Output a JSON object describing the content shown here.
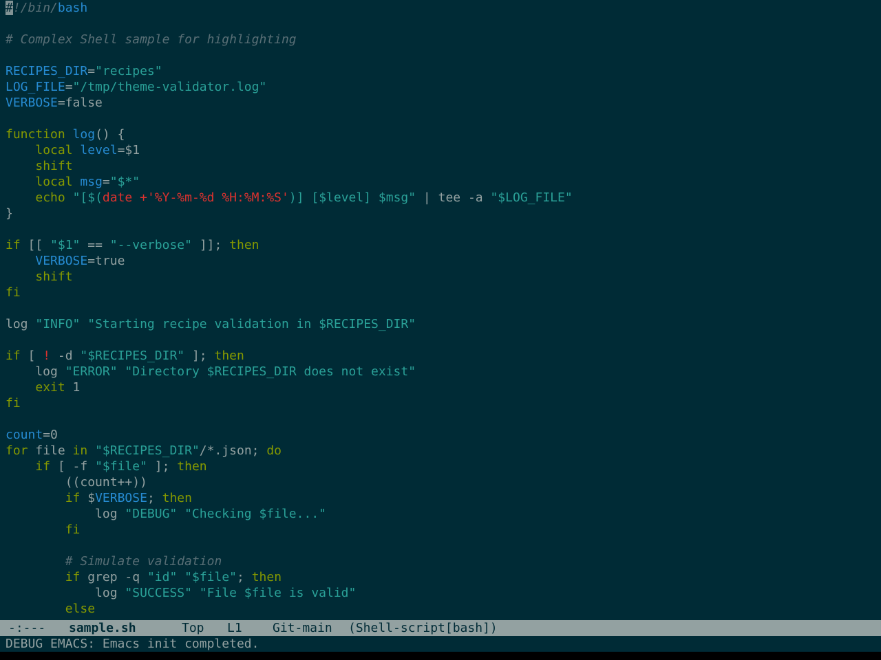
{
  "editor": {
    "lines": [
      [
        [
          "cursor",
          "#"
        ],
        [
          "comment",
          "!/bin/"
        ],
        [
          "var",
          "bash"
        ]
      ],
      [],
      [
        [
          "comment",
          "# Complex Shell sample for highlighting"
        ]
      ],
      [],
      [
        [
          "var",
          "RECIPES_DIR"
        ],
        [
          "text",
          "="
        ],
        [
          "string",
          "\"recipes\""
        ]
      ],
      [
        [
          "var",
          "LOG_FILE"
        ],
        [
          "text",
          "="
        ],
        [
          "string",
          "\"/tmp/theme-validator.log\""
        ]
      ],
      [
        [
          "var",
          "VERBOSE"
        ],
        [
          "text",
          "=false"
        ]
      ],
      [],
      [
        [
          "keyword",
          "function"
        ],
        [
          "text",
          " "
        ],
        [
          "var",
          "log"
        ],
        [
          "text",
          "() {"
        ]
      ],
      [
        [
          "text",
          "    "
        ],
        [
          "builtin",
          "local"
        ],
        [
          "text",
          " "
        ],
        [
          "var",
          "level"
        ],
        [
          "text",
          "=$1"
        ]
      ],
      [
        [
          "text",
          "    "
        ],
        [
          "builtin",
          "shift"
        ]
      ],
      [
        [
          "text",
          "    "
        ],
        [
          "builtin",
          "local"
        ],
        [
          "text",
          " "
        ],
        [
          "var",
          "msg"
        ],
        [
          "text",
          "="
        ],
        [
          "string",
          "\"$*\""
        ]
      ],
      [
        [
          "text",
          "    "
        ],
        [
          "builtin",
          "echo"
        ],
        [
          "text",
          " "
        ],
        [
          "string",
          "\"[$("
        ],
        [
          "interp",
          "date +'%Y-%m-%d %H:%M:%S'"
        ],
        [
          "string",
          ")] [$level] $msg\""
        ],
        [
          "text",
          " | tee -a "
        ],
        [
          "string",
          "\"$LOG_FILE\""
        ]
      ],
      [
        [
          "text",
          "}"
        ]
      ],
      [],
      [
        [
          "keyword",
          "if"
        ],
        [
          "text",
          " [[ "
        ],
        [
          "string",
          "\"$1\""
        ],
        [
          "text",
          " == "
        ],
        [
          "string",
          "\"--verbose\""
        ],
        [
          "text",
          " ]]; "
        ],
        [
          "keyword",
          "then"
        ]
      ],
      [
        [
          "text",
          "    "
        ],
        [
          "var",
          "VERBOSE"
        ],
        [
          "text",
          "=true"
        ]
      ],
      [
        [
          "text",
          "    "
        ],
        [
          "builtin",
          "shift"
        ]
      ],
      [
        [
          "keyword",
          "fi"
        ]
      ],
      [],
      [
        [
          "text",
          "log "
        ],
        [
          "string",
          "\"INFO\""
        ],
        [
          "text",
          " "
        ],
        [
          "string",
          "\"Starting recipe validation in $RECIPES_DIR\""
        ]
      ],
      [],
      [
        [
          "keyword",
          "if"
        ],
        [
          "text",
          " [ "
        ],
        [
          "interp",
          "!"
        ],
        [
          "text",
          " -d "
        ],
        [
          "string",
          "\"$RECIPES_DIR\""
        ],
        [
          "text",
          " ]; "
        ],
        [
          "keyword",
          "then"
        ]
      ],
      [
        [
          "text",
          "    log "
        ],
        [
          "string",
          "\"ERROR\""
        ],
        [
          "text",
          " "
        ],
        [
          "string",
          "\"Directory $RECIPES_DIR does not exist\""
        ]
      ],
      [
        [
          "text",
          "    "
        ],
        [
          "builtin",
          "exit"
        ],
        [
          "text",
          " 1"
        ]
      ],
      [
        [
          "keyword",
          "fi"
        ]
      ],
      [],
      [
        [
          "var",
          "count"
        ],
        [
          "text",
          "=0"
        ]
      ],
      [
        [
          "keyword",
          "for"
        ],
        [
          "text",
          " file "
        ],
        [
          "keyword",
          "in"
        ],
        [
          "text",
          " "
        ],
        [
          "string",
          "\"$RECIPES_DIR\""
        ],
        [
          "text",
          "/*.json; "
        ],
        [
          "keyword",
          "do"
        ]
      ],
      [
        [
          "text",
          "    "
        ],
        [
          "keyword",
          "if"
        ],
        [
          "text",
          " [ -f "
        ],
        [
          "string",
          "\"$file\""
        ],
        [
          "text",
          " ]; "
        ],
        [
          "keyword",
          "then"
        ]
      ],
      [
        [
          "text",
          "        ((count++))"
        ]
      ],
      [
        [
          "text",
          "        "
        ],
        [
          "keyword",
          "if"
        ],
        [
          "text",
          " $"
        ],
        [
          "var",
          "VERBOSE"
        ],
        [
          "text",
          "; "
        ],
        [
          "keyword",
          "then"
        ]
      ],
      [
        [
          "text",
          "            log "
        ],
        [
          "string",
          "\"DEBUG\""
        ],
        [
          "text",
          " "
        ],
        [
          "string",
          "\"Checking $file...\""
        ]
      ],
      [
        [
          "text",
          "        "
        ],
        [
          "keyword",
          "fi"
        ]
      ],
      [],
      [
        [
          "text",
          "        "
        ],
        [
          "comment",
          "# Simulate validation"
        ]
      ],
      [
        [
          "text",
          "        "
        ],
        [
          "keyword",
          "if"
        ],
        [
          "text",
          " grep -q "
        ],
        [
          "string",
          "\"id\""
        ],
        [
          "text",
          " "
        ],
        [
          "string",
          "\"$file\""
        ],
        [
          "text",
          "; "
        ],
        [
          "keyword",
          "then"
        ]
      ],
      [
        [
          "text",
          "            log "
        ],
        [
          "string",
          "\"SUCCESS\""
        ],
        [
          "text",
          " "
        ],
        [
          "string",
          "\"File $file is valid\""
        ]
      ],
      [
        [
          "text",
          "        "
        ],
        [
          "keyword",
          "else"
        ]
      ]
    ]
  },
  "modeline": {
    "status": "-:---",
    "buffer_name": "sample.sh",
    "position": "Top",
    "line": "L1",
    "vc": "Git-main",
    "mode": "(Shell-script[bash])"
  },
  "minibuffer": {
    "message": "DEBUG EMACS: Emacs init completed."
  },
  "colors": {
    "background": "#002b36",
    "foreground": "#93a1a1",
    "comment": "#586e75",
    "variable": "#268bd2",
    "keyword": "#859900",
    "string": "#2aa198",
    "interpolation": "#dc322f",
    "modeline_bg": "#93a1a1",
    "modeline_fg": "#002b36"
  }
}
